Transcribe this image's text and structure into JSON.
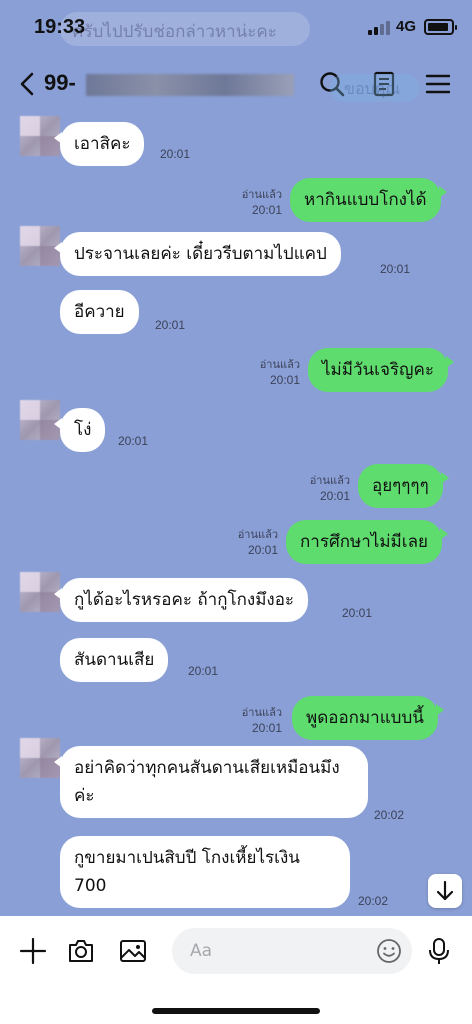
{
  "status_bar": {
    "time": "19:33",
    "network": "4G",
    "behind_banner_text": "ครับไปปรับช่อกล่าวหาน่ะคะ"
  },
  "header": {
    "contact_name": "99-",
    "behind_pill_text": "ขอบคุณ"
  },
  "messages": [
    {
      "side": "in",
      "text": "เอาสิคะ",
      "time": "20:01"
    },
    {
      "side": "out",
      "text": "หากินแบบโกงได้",
      "read": "อ่านแล้ว",
      "time": "20:01"
    },
    {
      "side": "in",
      "text": "ประจานเลยค่ะ เดี๋ยวรีบตามไปแคป",
      "time": "20:01"
    },
    {
      "side": "in",
      "text": "อีควาย",
      "time": "20:01"
    },
    {
      "side": "out",
      "text": "ไม่มีวันเจริญคะ",
      "read": "อ่านแล้ว",
      "time": "20:01"
    },
    {
      "side": "in",
      "text": "โง่",
      "time": "20:01"
    },
    {
      "side": "out",
      "text": "อุยๆๆๆๆ",
      "read": "อ่านแล้ว",
      "time": "20:01"
    },
    {
      "side": "out",
      "text": "การศึกษาไม่มีเลย",
      "read": "อ่านแล้ว",
      "time": "20:01"
    },
    {
      "side": "in",
      "text": "กูได้อะไรหรอคะ ถ้ากูโกงมึงอะ",
      "time": "20:01"
    },
    {
      "side": "in",
      "text": "สันดานเสีย",
      "time": "20:01"
    },
    {
      "side": "out",
      "text": "พูดออกมาแบบนี้",
      "read": "อ่านแล้ว",
      "time": "20:01"
    },
    {
      "side": "in",
      "text": "อย่าคิดว่าทุกคนสันดานเสียเหมือนมึงค่ะ",
      "time": "20:02"
    },
    {
      "side": "in",
      "text": "กูขายมาเปนสิบปี โกงเหี้ยไรเงิน 700",
      "time": "20:02"
    }
  ],
  "input": {
    "placeholder": "Aa"
  },
  "colors": {
    "background": "#8a9fd6",
    "outgoing_bubble": "#5fdc6e",
    "incoming_bubble": "#ffffff"
  },
  "icons": [
    "back-icon",
    "search-icon",
    "notes-icon",
    "menu-icon",
    "plus-icon",
    "camera-icon",
    "image-icon",
    "emoji-icon",
    "microphone-icon",
    "arrow-down-icon"
  ]
}
